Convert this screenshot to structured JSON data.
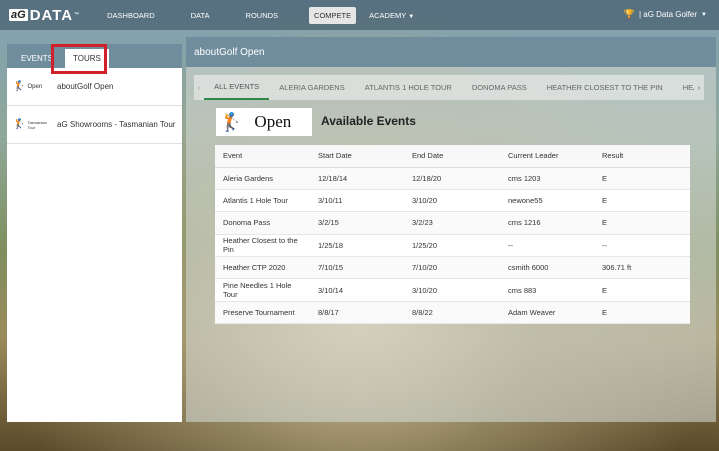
{
  "topbar": {
    "logo_ag": "aG",
    "logo_data": "DATA",
    "logo_tm": "™",
    "nav": [
      {
        "label": "DASHBOARD"
      },
      {
        "label": "DATA"
      },
      {
        "label": "ROUNDS"
      },
      {
        "label": "COMPETE"
      },
      {
        "label": "ACADEMY"
      }
    ],
    "user_label": "| aG Data Golfer"
  },
  "left": {
    "tabs": [
      {
        "label": "EVENTS"
      },
      {
        "label": "TOURS"
      }
    ],
    "tours": [
      {
        "logo_text": "Open",
        "name": "aboutGolf Open"
      },
      {
        "logo_text": "Tasmanian Tour",
        "name": "aG Showrooms - Tasmanian Tour"
      }
    ]
  },
  "right": {
    "header": "aboutGolf Open",
    "event_tabs": [
      {
        "label": "ALL EVENTS"
      },
      {
        "label": "ALERIA GARDENS"
      },
      {
        "label": "ATLANTIS 1 HOLE TOUR"
      },
      {
        "label": "DONOMA PASS"
      },
      {
        "label": "HEATHER CLOSEST TO THE PIN"
      },
      {
        "label": "HEA"
      }
    ],
    "banner_text": "Open",
    "available_title": "Available Events",
    "table": {
      "headers": [
        "Event",
        "Start Date",
        "End Date",
        "Current Leader",
        "Result"
      ],
      "rows": [
        [
          "Aleria Gardens",
          "12/18/14",
          "12/18/20",
          "cms 1203",
          "E"
        ],
        [
          "Atlantis 1 Hole Tour",
          "3/10/11",
          "3/10/20",
          "newone55",
          "E"
        ],
        [
          "Donoma Pass",
          "3/2/15",
          "3/2/23",
          "cms 1216",
          "E"
        ],
        [
          "Heather Closest to the Pin",
          "1/25/18",
          "1/25/20",
          "--",
          "--"
        ],
        [
          "Heather CTP 2020",
          "7/10/15",
          "7/10/20",
          "csmith 6000",
          "306.71 ft"
        ],
        [
          "Pine Needles 1 Hole Tour",
          "3/10/14",
          "3/10/20",
          "cms 883",
          "E"
        ],
        [
          "Preserve Tournament",
          "8/8/17",
          "8/8/22",
          "Adam Weaver",
          "E"
        ]
      ]
    }
  },
  "colors": {
    "header_bg": "#708d9e",
    "active_tab_underline": "#2f8a4a",
    "highlight": "#d0202a"
  }
}
